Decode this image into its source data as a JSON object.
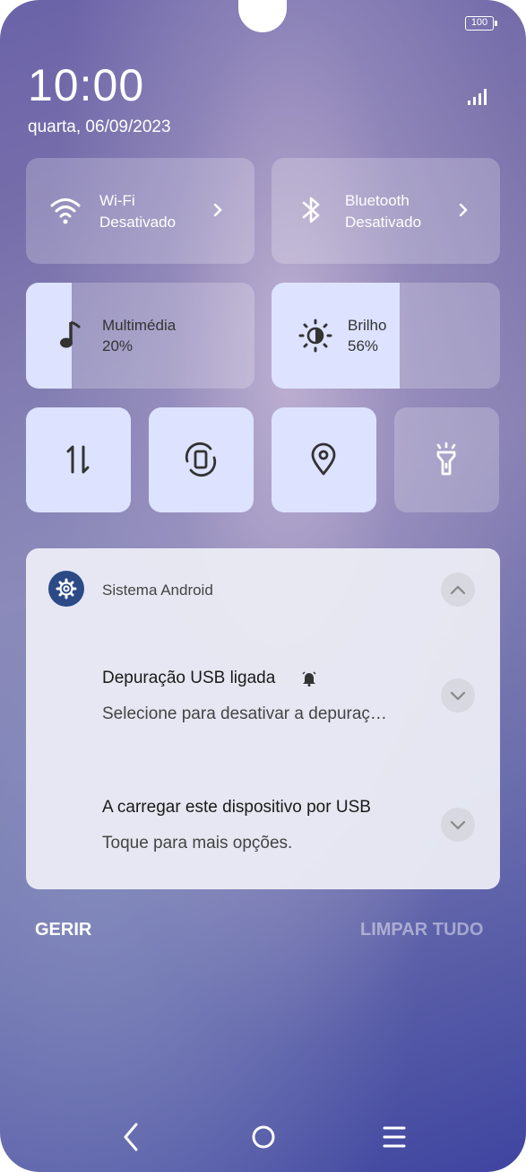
{
  "status_bar": {
    "battery": "100"
  },
  "clock": {
    "time": "10:00",
    "date": "quarta, 06/09/2023"
  },
  "tiles": {
    "wifi": {
      "label": "Wi-Fi",
      "status": "Desativado"
    },
    "bluetooth": {
      "label": "Bluetooth",
      "status": "Desativado"
    },
    "media": {
      "label": "Multimédia",
      "value": "20%",
      "level": 0.2
    },
    "brightness": {
      "label": "Brilho",
      "value": "56%",
      "level": 0.56
    }
  },
  "toggles": [
    {
      "icon": "mobile-data-icon",
      "active": true
    },
    {
      "icon": "auto-rotate-icon",
      "active": true
    },
    {
      "icon": "location-icon",
      "active": true
    },
    {
      "icon": "flashlight-icon",
      "active": false
    }
  ],
  "notification_group": {
    "app": "Sistema Android",
    "notifications": [
      {
        "title": "Depuração USB ligada",
        "text": "Selecione para desativar a depuraç…"
      },
      {
        "title": "A carregar este dispositivo por USB",
        "text": "Toque para mais opções."
      }
    ]
  },
  "actions": {
    "manage": "GERIR",
    "clear_all": "LIMPAR TUDO"
  },
  "colors": {
    "active_tile": "#dde3ff",
    "app_icon": "#2b4a86"
  }
}
